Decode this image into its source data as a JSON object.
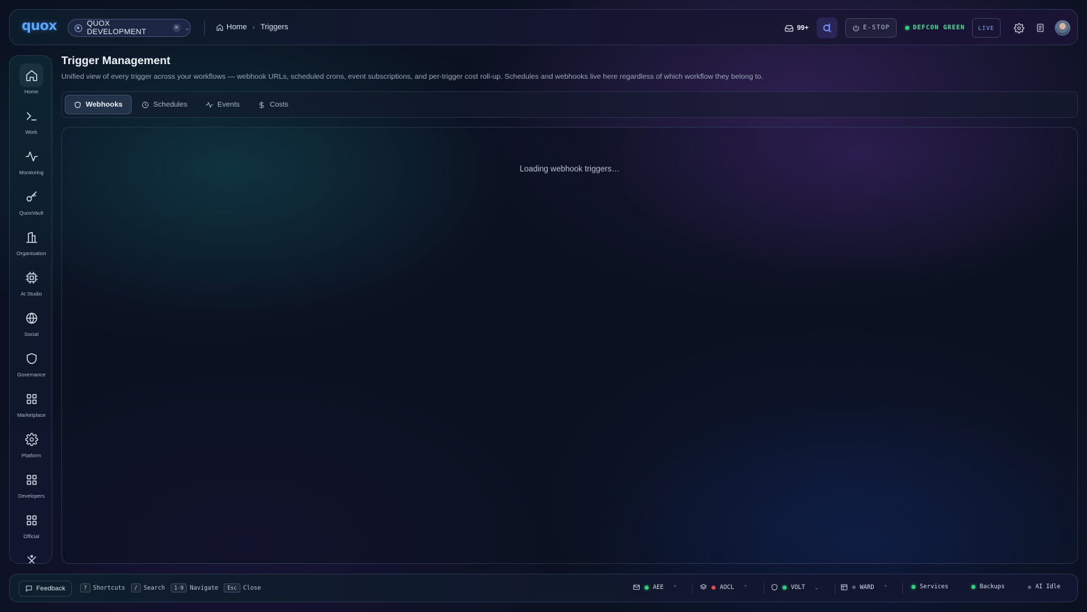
{
  "header": {
    "logo": "quox",
    "org": "QUOX DEVELOPMENT",
    "breadcrumb": [
      "Home",
      "Triggers"
    ],
    "inbox_count": "99+",
    "estop": "E-STOP",
    "defcon": "DEFCON GREEN",
    "live": "LIVE"
  },
  "sidebar": {
    "items": [
      {
        "label": "Home",
        "icon": "home-icon"
      },
      {
        "label": "Work",
        "icon": "terminal-icon"
      },
      {
        "label": "Monitoring",
        "icon": "activity-icon"
      },
      {
        "label": "QuoxVault",
        "icon": "key-icon"
      },
      {
        "label": "Organisation",
        "icon": "building-icon"
      },
      {
        "label": "AI Studio",
        "icon": "cpu-icon"
      },
      {
        "label": "Social",
        "icon": "globe-icon"
      },
      {
        "label": "Governance",
        "icon": "shield-icon"
      },
      {
        "label": "Marketplace",
        "icon": "grid-icon"
      },
      {
        "label": "Platform",
        "icon": "gear-icon"
      },
      {
        "label": "Developers",
        "icon": "grid-icon"
      },
      {
        "label": "Official",
        "icon": "grid-icon"
      }
    ]
  },
  "page": {
    "title": "Trigger Management",
    "description": "Unified view of every trigger across your workflows — webhook URLs, scheduled crons, event subscriptions, and per-trigger cost roll-up. Schedules and webhooks live here regardless of which workflow they belong to.",
    "tabs": [
      {
        "label": "Webhooks",
        "icon": "shield-icon",
        "active": true
      },
      {
        "label": "Schedules",
        "icon": "clock-icon",
        "active": false
      },
      {
        "label": "Events",
        "icon": "activity-icon",
        "active": false
      },
      {
        "label": "Costs",
        "icon": "dollar-icon",
        "active": false
      }
    ],
    "loading": "Loading webhook triggers…"
  },
  "footer": {
    "feedback": "Feedback",
    "shortcuts": [
      {
        "key": "?",
        "label": "Shortcuts"
      },
      {
        "key": "/",
        "label": "Search"
      },
      {
        "key": "1-9",
        "label": "Navigate"
      },
      {
        "key": "Esc",
        "label": "Close"
      }
    ],
    "status": [
      {
        "label": "AEE",
        "state": "green"
      },
      {
        "label": "AOCL",
        "state": "red"
      },
      {
        "label": "VOLT",
        "state": "green"
      },
      {
        "label": "WARD",
        "state": "grey"
      },
      {
        "label": "Services",
        "state": "green"
      },
      {
        "label": "Backups",
        "state": "green"
      },
      {
        "label": "AI Idle",
        "state": "grey"
      }
    ]
  },
  "colors": {
    "accent": "#5aa7ff",
    "ok": "#33d17a",
    "error": "#e5484d",
    "background": "#0b1120"
  }
}
